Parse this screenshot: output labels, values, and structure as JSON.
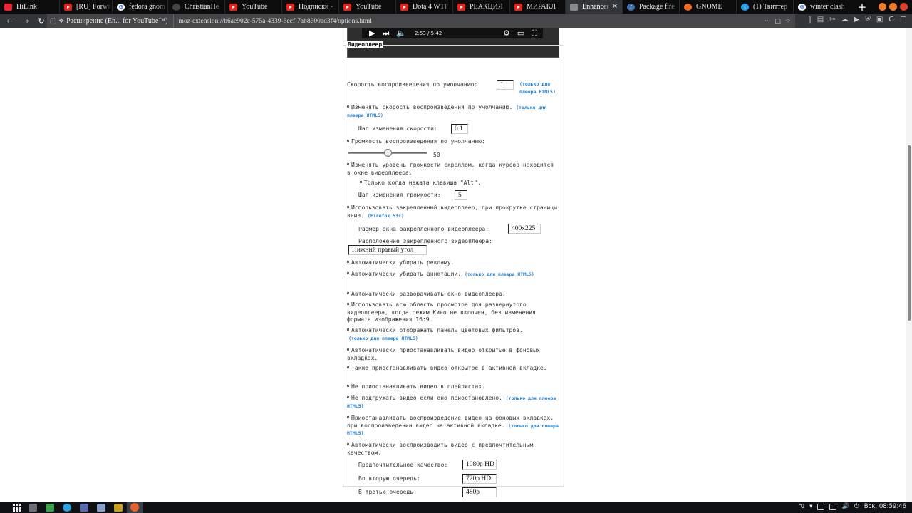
{
  "tabs": [
    {
      "title": "HiLink",
      "icon": "hilink-icon",
      "fav": "fav-hl",
      "width": 84
    },
    {
      "title": "[RU] Forwa",
      "icon": "youtube-icon",
      "fav": "fav-yt",
      "width": 74
    },
    {
      "title": "fedora gnom",
      "icon": "google-icon",
      "fav": "fav-g",
      "width": 78
    },
    {
      "title": "ChristianHe",
      "icon": "github-icon",
      "fav": "fav-gh",
      "width": 80
    },
    {
      "title": "YouTube",
      "icon": "youtube-icon",
      "fav": "fav-yt",
      "width": 80
    },
    {
      "title": "Подписки -",
      "icon": "youtube-icon",
      "fav": "fav-yt",
      "width": 80
    },
    {
      "title": "YouTube",
      "icon": "youtube-icon",
      "fav": "fav-yt",
      "width": 80
    },
    {
      "title": "Dota 4 WTF",
      "icon": "youtube-icon",
      "fav": "fav-yt",
      "width": 80
    },
    {
      "title": "РЕАКЦИЯ",
      "icon": "youtube-icon",
      "fav": "fav-yt",
      "width": 80
    },
    {
      "title": "МИРАКЛ",
      "icon": "youtube-icon",
      "fav": "fav-yt",
      "width": 78
    },
    {
      "title": "Enhancer for",
      "icon": "extension-icon",
      "fav": "fav-ext",
      "width": 80,
      "active": true
    },
    {
      "title": "Package fire",
      "icon": "fedora-icon",
      "fav": "fav-fed",
      "width": 80
    },
    {
      "title": "GNOME",
      "icon": "gnome-icon",
      "fav": "fav-gn",
      "width": 80
    },
    {
      "title": "(1) Твиттер",
      "icon": "twitter-icon",
      "fav": "fav-tw",
      "width": 80
    },
    {
      "title": "winter clash",
      "icon": "google-icon",
      "fav": "fav-g",
      "width": 78
    }
  ],
  "nav": {
    "identity": "Расширение (En... for YouTube™)",
    "url": "moz-extension://b6ae902c-575a-4339-8cef-7ab8600ad3f4/options.html"
  },
  "video": {
    "time": "2:53 / 5:42"
  },
  "section": {
    "title": "Видеоплеер"
  },
  "options": {
    "speed_label": "Скорость воспроизведения по умолчанию:",
    "speed_value": "1",
    "html5_note": "(только для плеера HTML5)",
    "change_speed": "Изменять скорость воспроизведения по умолчанию.",
    "speed_step_label": "Шаг изменения скорости:",
    "speed_step_value": "0.1",
    "volume_label": "Громкость воспроизведения по умолчанию:",
    "volume_value": "50",
    "volume_level": 0.5,
    "scroll_volume": "Изменять уровень громкости скроллом, когда курсор находится в окне видеоплеера.",
    "alt_only": "Только когда нажата клавиша \"Alt\".",
    "volume_step_label": "Шаг изменения громкости:",
    "volume_step_value": "5",
    "pinned_player": "Использовать закрепленный видеоплеер, при прокрутке страницы вниз.",
    "firefox_note": "(Firefox 53+)",
    "pinned_size_label": "Размер окна закрепленного видеоплеера:",
    "pinned_size_value": "400x225",
    "pinned_pos_label": "Расположение закрепленного видеоплеера:",
    "pinned_pos_value": "Нижний правый угол",
    "remove_ads": "Автоматически убирать рекламу.",
    "remove_annotations": "Автоматически убирать аннотации.",
    "expand_player": "Автоматически разворачивать окно видеоплеера.",
    "full_area": "Использовать всю область просмотра для развернутого видеоплеера, когда режим Кино не включен, без изменения формата изображения 16:9.",
    "color_filters": "Автоматически отображать панель цветовых фильтров.",
    "pause_background": "Автоматически приостанавливать видео открытые в фоновых вкладках.",
    "pause_active": "Также приостанавливать видео открытое в активной вкладке.",
    "no_pause_playlists": "Не приостанавливать видео в плейлистах.",
    "no_preload": "Не подгружать видео если оно приостановлено.",
    "pause_on_active": "Приостанавливать воспроизведение видео на фоновых вкладках, при воспроизведении видео на активной вкладке.",
    "auto_quality": "Автоматически воспроизводить видео с предпочтительным качеством.",
    "quality1_label": "Предпочтительное качество:",
    "quality1_value": "1080p HD",
    "quality2_label": "Во вторую очередь:",
    "quality2_value": "720p HD",
    "quality3_label": "В третью очередь:",
    "quality3_value": "480p"
  },
  "taskbar": {
    "layout": "ru",
    "clock": "Вск, 08:59:46"
  }
}
